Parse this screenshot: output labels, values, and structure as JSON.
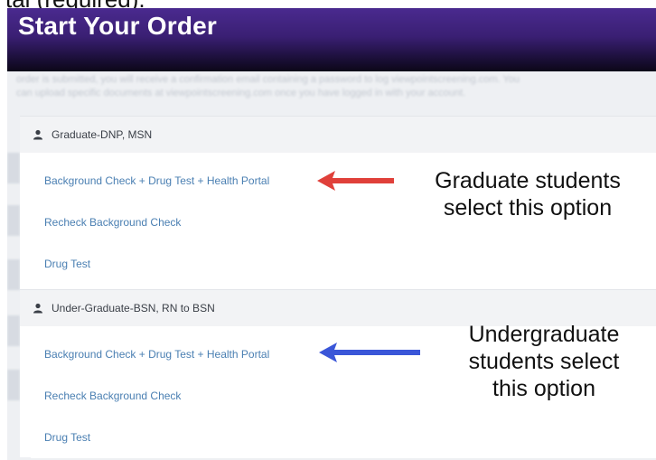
{
  "top_strip_text": "tal (required).",
  "header": {
    "title": "Start Your Order"
  },
  "intro_text": "order is submitted, you will receive a confirmation email containing a password to log viewpointscreening.com. You can upload specific documents at viewpointscreening.com once you have logged in with your account.",
  "groups": [
    {
      "name": "Graduate-DNP, MSN",
      "options": [
        "Background Check + Drug Test + Health Portal",
        "Recheck Background Check",
        "Drug Test"
      ]
    },
    {
      "name": "Under-Graduate-BSN, RN to BSN",
      "options": [
        "Background Check + Drug Test + Health Portal",
        "Recheck Background Check",
        "Drug Test"
      ]
    }
  ],
  "annotations": {
    "graduate": [
      "Graduate students",
      "select this option"
    ],
    "undergraduate": [
      "Undergraduate",
      "students select",
      "this option"
    ]
  },
  "colors": {
    "header_gradient_top": "#4a2a8f",
    "header_gradient_bottom": "#0c0718",
    "link": "#4a7fb2",
    "arrow_red": "#e0403a",
    "arrow_blue": "#3a56d8"
  }
}
